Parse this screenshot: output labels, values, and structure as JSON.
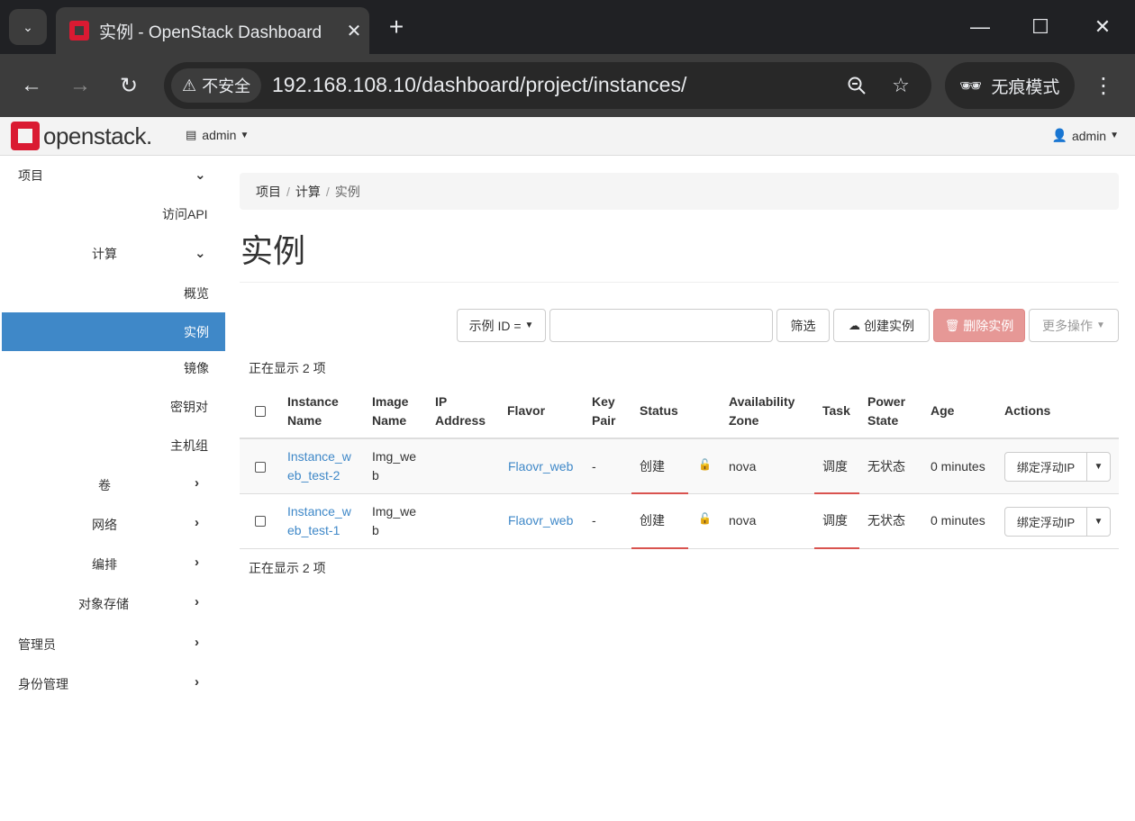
{
  "browser": {
    "tab_title": "实例 - OpenStack Dashboard",
    "insecure_label": "不安全",
    "url": "192.168.108.10/dashboard/project/instances/",
    "incognito_label": "无痕模式"
  },
  "header": {
    "logo_text": "openstack.",
    "project_label": "admin",
    "user_label": "admin"
  },
  "sidebar": {
    "project": "项目",
    "api_access": "访问API",
    "compute": "计算",
    "overview": "概览",
    "instances": "实例",
    "images": "镜像",
    "keypairs": "密钥对",
    "server_groups": "主机组",
    "volumes": "卷",
    "network": "网络",
    "orchestration": "编排",
    "object_store": "对象存储",
    "admin": "管理员",
    "identity": "身份管理"
  },
  "breadcrumb": {
    "items": [
      "项目",
      "计算",
      "实例"
    ]
  },
  "page": {
    "title": "实例",
    "count_label": "正在显示 2 项"
  },
  "toolbar": {
    "filter_select": "示例 ID =",
    "filter_button": "筛选",
    "launch_button": "创建实例",
    "delete_button": "删除实例",
    "more_actions": "更多操作"
  },
  "table": {
    "headers": {
      "instance_name_1": "Instance",
      "instance_name_2": "Name",
      "image_name_1": "Image",
      "image_name_2": "Name",
      "ip_1": "IP",
      "ip_2": "Address",
      "flavor": "Flavor",
      "key_pair_1": "Key",
      "key_pair_2": "Pair",
      "status": "Status",
      "az_1": "Availability",
      "az_2": "Zone",
      "task": "Task",
      "power_1": "Power",
      "power_2": "State",
      "age": "Age",
      "actions": "Actions"
    },
    "rows": [
      {
        "name_1": "Instance_w",
        "name_2": "eb_test-2",
        "image_1": "Img_we",
        "image_2": "b",
        "ip": "",
        "flavor": "Flaovr_web",
        "key_pair": "-",
        "status": "创建",
        "az": "nova",
        "task": "调度",
        "power": "无状态",
        "age": "0 minutes",
        "action": "绑定浮动IP"
      },
      {
        "name_1": "Instance_w",
        "name_2": "eb_test-1",
        "image_1": "Img_we",
        "image_2": "b",
        "ip": "",
        "flavor": "Flaovr_web",
        "key_pair": "-",
        "status": "创建",
        "az": "nova",
        "task": "调度",
        "power": "无状态",
        "age": "0 minutes",
        "action": "绑定浮动IP"
      }
    ]
  },
  "colors": {
    "accent": "#3f88c8",
    "danger": "#e69896",
    "brand": "#da1a32"
  }
}
